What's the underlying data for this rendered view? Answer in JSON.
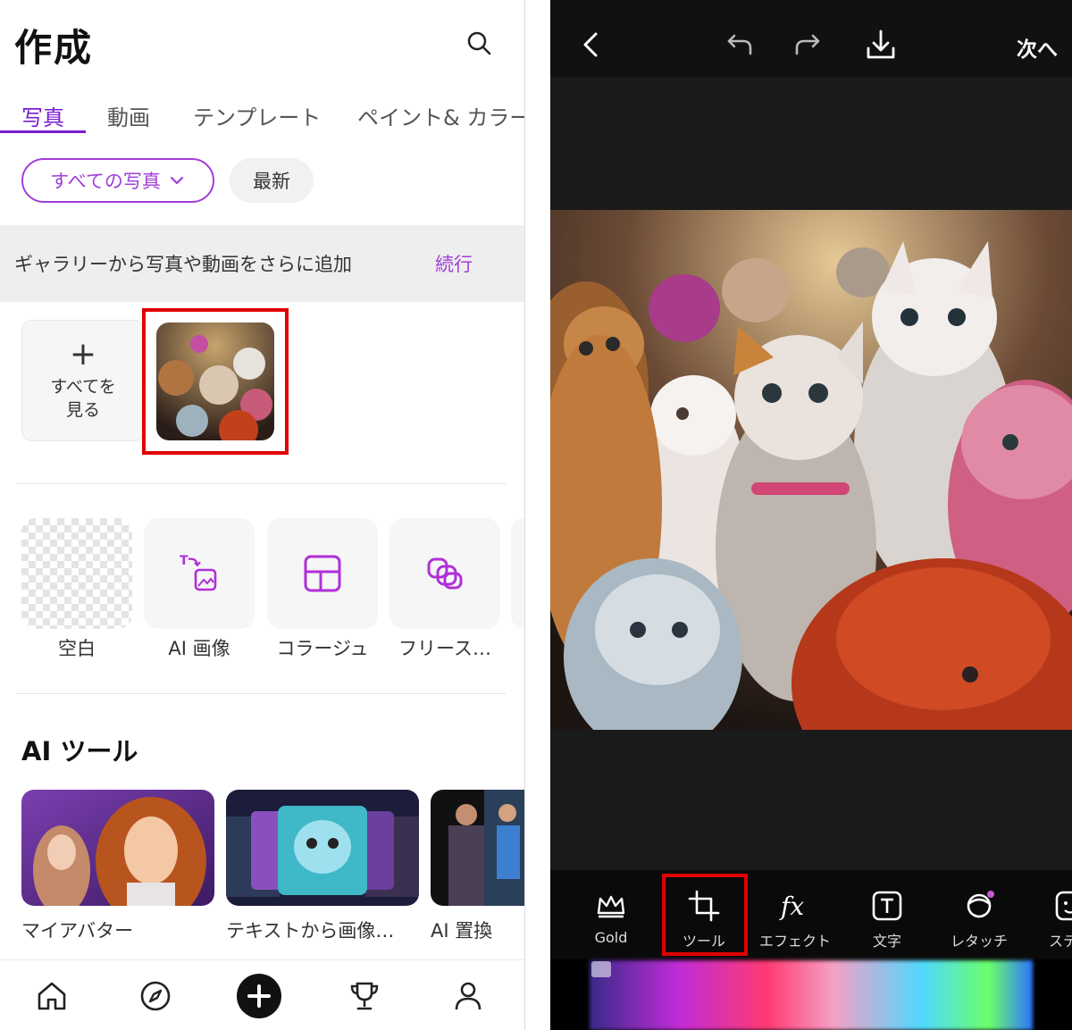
{
  "left": {
    "title": "作成",
    "tabs": [
      "写真",
      "動画",
      "テンプレート",
      "ペイント& カラー"
    ],
    "filter_chip": "すべての写真",
    "latest_chip": "最新",
    "banner": {
      "text": "ギャラリーから写真や動画をさらに追加",
      "link": "続行"
    },
    "see_all": {
      "line1": "すべてを",
      "line2": "見る"
    },
    "tools": [
      "空白",
      "AI 画像",
      "コラージュ",
      "フリース…"
    ],
    "ai_tools_title": "AI ツール",
    "ai_tools": [
      "マイアバター",
      "テキストから画像…",
      "AI 置換"
    ],
    "nav": [
      "home-icon",
      "compass-icon",
      "plus-icon",
      "trophy-icon",
      "profile-icon"
    ],
    "accent_color": "#a03ed8",
    "highlight_color": "#e00000"
  },
  "right": {
    "next_label": "次へ",
    "toolbar": [
      "Gold",
      "ツール",
      "エフェクト",
      "文字",
      "レタッチ",
      "ステッ"
    ]
  }
}
